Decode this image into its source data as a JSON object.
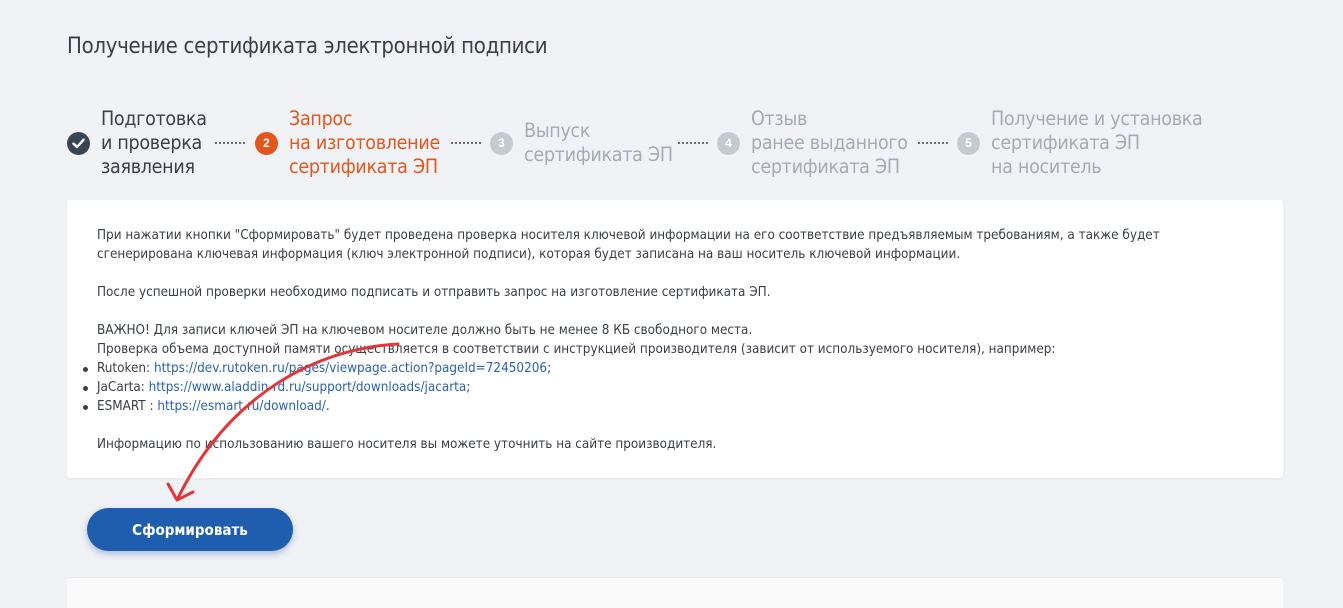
{
  "page": {
    "title": "Получение сертификата электронной подписи"
  },
  "stepper": {
    "steps": [
      {
        "state": "done",
        "icon": "check-icon",
        "badge": "",
        "lines": [
          "Подготовка",
          "и проверка",
          "заявления"
        ]
      },
      {
        "state": "active",
        "icon": "step-number-icon",
        "badge": "2",
        "lines": [
          "Запрос",
          "на изготовление",
          "сертификата ЭП"
        ]
      },
      {
        "state": "pending",
        "icon": "step-number-icon",
        "badge": "3",
        "lines": [
          "Выпуск",
          "сертификата ЭП"
        ]
      },
      {
        "state": "pending",
        "icon": "step-number-icon",
        "badge": "4",
        "lines": [
          "Отзыв",
          "ранее выданного",
          "сертификата ЭП"
        ]
      },
      {
        "state": "pending",
        "icon": "step-number-icon",
        "badge": "5",
        "lines": [
          "Получение и установка",
          "сертификата ЭП",
          "на носитель"
        ]
      }
    ]
  },
  "info": {
    "p1": "При нажатии кнопки \"Сформировать\" будет проведена проверка носителя ключевой информации на его соответствие предъявляемым требованиям, а также будет сгенерирована ключевая информация (ключ электронной подписи), которая будет записана на ваш носитель ключевой информации.",
    "p2": "После успешной проверки необходимо подписать и отправить запрос на изготовление сертификата ЭП.",
    "p3": "ВАЖНО! Для записи ключей ЭП на ключевом носителе должно быть не менее 8 КБ свободного места.",
    "p4": "Проверка объема доступной памяти осуществляется в соответствии с инструкцией производителя (зависит от используемого носителя), например:",
    "links": [
      {
        "prefix": "Rutoken: ",
        "url": "https://dev.rutoken.ru/pages/viewpage.action?pageId=72450206",
        "suffix": ";"
      },
      {
        "prefix": "JaCarta: ",
        "url": "https://www.aladdin-rd.ru/support/downloads/jacarta",
        "suffix": ";"
      },
      {
        "prefix": "ESMART : ",
        "url": "https://esmart.ru/download/",
        "suffix": "."
      }
    ],
    "p5": "Информацию по использованию вашего носителя вы можете уточнить на сайте производителя."
  },
  "actions": {
    "submit_label": "Сформировать"
  },
  "colors": {
    "accent_active": "#e4571c",
    "step_done": "#3a4553",
    "step_pending": "#c5cad0",
    "button": "#1f5eaf",
    "link": "#2a62ad",
    "annotation_arrow": "#e0383a"
  }
}
